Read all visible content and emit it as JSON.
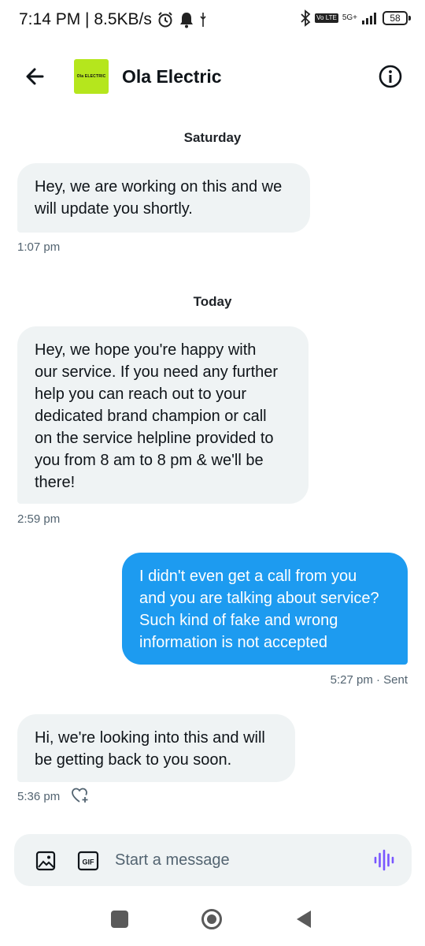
{
  "status": {
    "time_speed": "7:14 PM | 8.5KB/s",
    "network": "5G+",
    "volte": "Vo LTE",
    "battery": "58"
  },
  "header": {
    "title": "Ola Electric",
    "logo_text": "Ola ELECTRIC"
  },
  "messages": [
    {
      "date": "Saturday"
    },
    {
      "text": "Hey, we are working on this and we\nwill update you shortly.",
      "time": "1:07 pm"
    },
    {
      "date": "Today"
    },
    {
      "text": "Hey, we hope you're happy with\nour service. If you need any further\nhelp you can reach out to your\ndedicated brand champion or call\non the service helpline provided to\nyou from 8 am to 8 pm & we'll be\nthere!",
      "time": "2:59 pm"
    },
    {
      "text": "I didn't even get a call from you\nand you are talking about service?\nSuch kind of fake and wrong\ninformation is not accepted",
      "time": "5:27 pm · Sent"
    },
    {
      "text": "Hi, we're looking into this and will\nbe getting back to you soon.",
      "time": "5:36 pm"
    }
  ],
  "composer": {
    "placeholder": "Start a message",
    "gif_label": "GIF"
  },
  "colors": {
    "accent": "#1d9bf0",
    "incoming_bubble": "#eff3f4",
    "logo_bg": "#b5e61d",
    "voice_icon": "#7856ff"
  }
}
